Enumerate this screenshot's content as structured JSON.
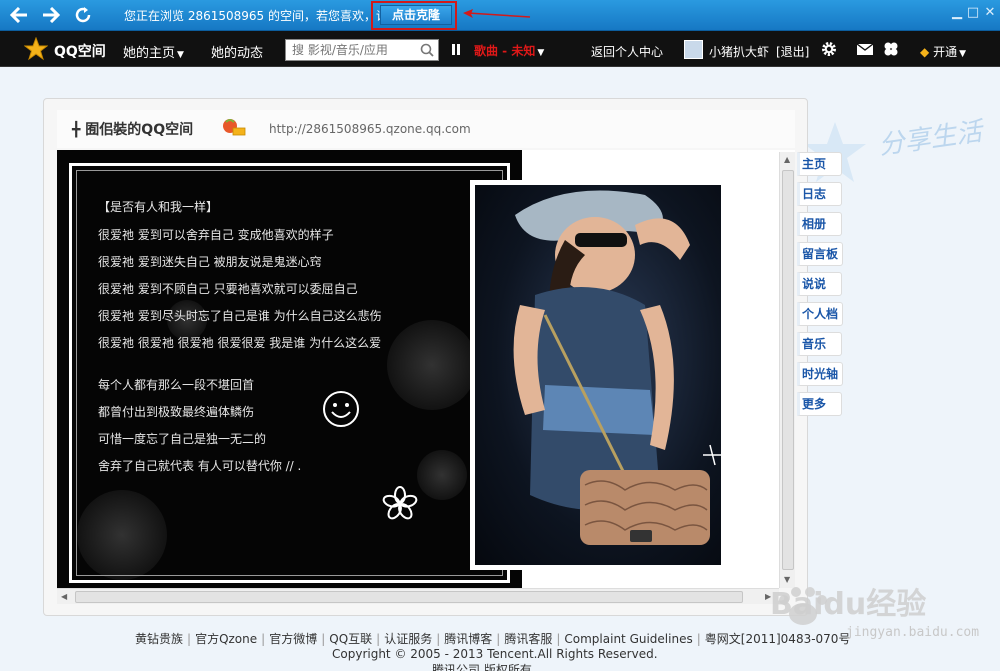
{
  "topbar": {
    "back_icon": "arrow-left-icon",
    "forward_icon": "arrow-right-icon",
    "refresh_icon": "refresh-icon",
    "browse_notice": "您正在浏览 2861508965 的空间，若您喜欢，请",
    "clone_button": "点击克隆",
    "accent_color": "#1c86d2",
    "highlight_color": "#d21a1a"
  },
  "qqbar": {
    "brand": "QQ空间",
    "menu_home": "她的主页",
    "menu_feed": "她的动态",
    "search_placeholder": "搜 影视/音乐/应用",
    "music_title": "歌曲 - 未知",
    "back_center": "返回个人中心",
    "username": "小猪扒大虾",
    "logout": "[退出]",
    "open_vip": "开通"
  },
  "space": {
    "title": "╋ 囿佀裝的QQ空间",
    "url": "http://2861508965.qzone.qq.com"
  },
  "poem": {
    "heading": "【是否有人和我一样】",
    "lines": [
      "很爱祂  爱到可以舍弃自己  变成他喜欢的样子",
      "很爱祂  爱到迷失自己  被朋友说是鬼迷心窍",
      "很爱祂  爱到不顾自己  只要祂喜欢就可以委屈自己",
      "很爱祂  爱到尽头时忘了自己是谁  为什么自己这么悲伤",
      "很爱祂  很爱祂  很爱祂  很爱很爱  我是谁  为什么这么爱",
      "每个人都有那么一段不堪回首",
      "都曾付出到极致最终遍体鳞伤",
      "可惜一度忘了自己是独一无二的",
      "舍弃了自己就代表  有人可以替代你    //  ."
    ]
  },
  "side_nav": [
    "主页",
    "日志",
    "相册",
    "留言板",
    "说说",
    "个人档",
    "音乐",
    "时光轴",
    "更多"
  ],
  "footer": {
    "links": [
      "黄钻贵族",
      "官方Qzone",
      "官方微博",
      "QQ互联",
      "认证服务",
      "腾讯博客",
      "腾讯客服",
      "Complaint Guidelines",
      "粤网文[2011]0483-070号"
    ],
    "copyright": "Copyright © 2005 - 2013 Tencent.All Rights Reserved.",
    "company": "腾讯公司 版权所有"
  },
  "watermark": {
    "brand": "Baidu经验",
    "url": "jingyan.baidu.com"
  }
}
